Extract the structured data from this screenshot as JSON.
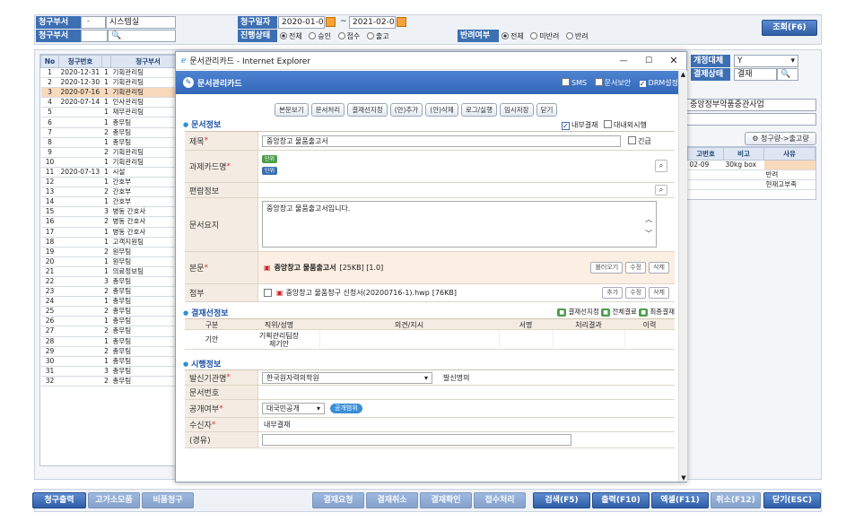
{
  "filters": {
    "req_dept_label": "청구부서",
    "req_dept_code": "ㆍ",
    "req_dept_name": "시스템실",
    "req_dept2_label": "청구부서",
    "req_date_label": "청구일자",
    "date_from": "2020-01-09",
    "date_tilde": "~",
    "date_to": "2021-02-09",
    "status_label": "진행상태",
    "status_options": [
      "전체",
      "승인",
      "접수",
      "출고"
    ],
    "return_label": "반려여부",
    "return_options": [
      "전체",
      "미반려",
      "반려"
    ],
    "query_btn": "조회(F6)"
  },
  "table": {
    "headers": [
      "No",
      "청구번호",
      "",
      "청구부서"
    ],
    "rows": [
      [
        "1",
        "2020-12-31",
        "1",
        "기획관리팀"
      ],
      [
        "2",
        "2020-12-30",
        "1",
        "기획관리팀"
      ],
      [
        "3",
        "2020-07-16",
        "1",
        "기획관리팀"
      ],
      [
        "4",
        "2020-07-14",
        "1",
        "인사관리팀"
      ],
      [
        "5",
        "",
        "1",
        "재무관리팀"
      ],
      [
        "6",
        "",
        "1",
        "총무팀"
      ],
      [
        "7",
        "",
        "2",
        "총무팀"
      ],
      [
        "8",
        "",
        "1",
        "총무팀"
      ],
      [
        "9",
        "",
        "2",
        "기획관리팀"
      ],
      [
        "10",
        "",
        "1",
        "기획관리팀"
      ],
      [
        "11",
        "2020-07-13",
        "1",
        "시설"
      ],
      [
        "12",
        "",
        "1",
        "간호부"
      ],
      [
        "13",
        "",
        "2",
        "간호부"
      ],
      [
        "14",
        "",
        "1",
        "간호부"
      ],
      [
        "15",
        "",
        "3",
        "병동 간호사"
      ],
      [
        "16",
        "",
        "2",
        "병동 간호사"
      ],
      [
        "17",
        "",
        "1",
        "병동 간호사"
      ],
      [
        "18",
        "",
        "1",
        "고객지원팀"
      ],
      [
        "19",
        "",
        "2",
        "원무팀"
      ],
      [
        "20",
        "",
        "1",
        "원무팀"
      ],
      [
        "21",
        "",
        "1",
        "의료정보팀"
      ],
      [
        "22",
        "",
        "3",
        "총무팀"
      ],
      [
        "23",
        "",
        "2",
        "총무팀"
      ],
      [
        "24",
        "",
        "1",
        "총무팀"
      ],
      [
        "25",
        "",
        "2",
        "총무팀"
      ],
      [
        "26",
        "",
        "1",
        "총무팀"
      ],
      [
        "27",
        "",
        "2",
        "총무팀"
      ],
      [
        "28",
        "",
        "1",
        "총무팀"
      ],
      [
        "29",
        "",
        "2",
        "총무팀"
      ],
      [
        "30",
        "",
        "1",
        "총무팀"
      ],
      [
        "31",
        "",
        "3",
        "총무팀"
      ],
      [
        "32",
        "",
        "2",
        "총무팀"
      ]
    ]
  },
  "right": {
    "item_label": "개정대체",
    "item_value": "Y",
    "result_label": "결제상태",
    "result_value": "결재",
    "desc": "중앙정부약품중관사업",
    "to_stock_btn": "청구량->출고량",
    "headers": [
      "고번호",
      "비고",
      "사유"
    ],
    "rows": [
      [
        "02-09",
        "30kg box",
        "",
        ""
      ],
      [
        "",
        "",
        "반려",
        ""
      ],
      [
        "",
        "",
        "현재고부족",
        ""
      ]
    ]
  },
  "popup": {
    "window_title": "문서관리카드 - Internet Explorer",
    "header_title": "문서관리카드",
    "top_checks": [
      "SMS",
      "문서보안",
      "DRM설정"
    ],
    "toolbar": [
      "본문보기",
      "문서처리",
      "결재선지정",
      "(안)추가",
      "(안)삭제",
      "로그/실행",
      "임시저장",
      "닫기"
    ],
    "doc_section": "문서정보",
    "internal_check": "내부결재",
    "external_check": "대내외시행",
    "subject_label": "제목",
    "subject_value": "중앙창고 물품출고서",
    "urgent": "긴급",
    "task_label": "과제카드명",
    "task_tag1": "단위",
    "task_tag2": "단위",
    "pub_label": "편람정보",
    "summary_label": "문서요지",
    "summary_value": "중앙창고 물품출고서입니다.",
    "body_label": "본문",
    "body_file": "중앙창고 물품출고서",
    "body_size": "[25KB] [1.0]",
    "body_btns": [
      "불러오기",
      "수정",
      "삭제"
    ],
    "attach_label": "첨부",
    "attach_file": "중앙창고 물품청구 신청서(20200716-1).hwp",
    "attach_size": "[76KB]",
    "attach_btns": [
      "추가",
      "수정",
      "삭제"
    ],
    "approval_section": "결재선정보",
    "approval_legend": [
      "결재선지정",
      "전체결료",
      "최종결재"
    ],
    "approval_headers": [
      "구분",
      "직위/성명",
      "의견/지시",
      "서명",
      "처리결과",
      "이력"
    ],
    "approval_row": [
      "기안",
      "기획관리팀장",
      "",
      ""
    ],
    "approval_person": "제기안",
    "detail_section": "시행정보",
    "org_label": "발신기관명",
    "org_value": "한국원자력의학원",
    "sender_label": "발신명의",
    "docno_label": "문서번호",
    "public_label": "공개여부",
    "public_value": "대국민공개",
    "public_btn": "공개범위",
    "recv_label": "수신자",
    "recv_value": "내부결재",
    "via_label": "(경유)"
  },
  "footer": {
    "btns_left": [
      "청구출력",
      "고가소모품",
      "비품청구"
    ],
    "btns_mid": [
      "결재요청",
      "결재취소",
      "결재확인",
      "접수처리"
    ],
    "search": "검색(F5)",
    "print": "출력(F10)",
    "excel": "엑셀(F11)",
    "cancel": "취소(F12)",
    "close": "닫기(ESC)"
  }
}
